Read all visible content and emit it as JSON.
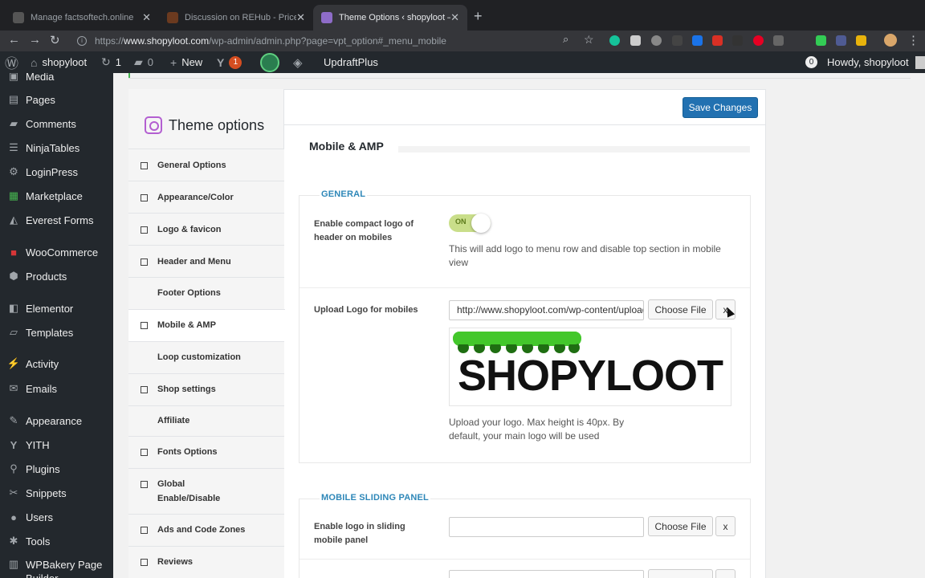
{
  "browser": {
    "tabs": [
      {
        "title": "Manage factsoftech.online",
        "active": false
      },
      {
        "title": "Discussion on REHub - Price C",
        "active": false
      },
      {
        "title": "Theme Options ‹ shopyloot —",
        "active": true
      }
    ],
    "url": {
      "scheme": "https://",
      "host": "www.shopyloot.com",
      "path": "/wp-admin/admin.php?page=vpt_option#_menu_mobile"
    }
  },
  "adminbar": {
    "site_name": "shopyloot",
    "updates_count": "1",
    "comments_count": "0",
    "new_label": "New",
    "yoast_badge": "1",
    "updraft_label": "UpdraftPlus",
    "notif_count": "0",
    "howdy": "Howdy, shopyloot"
  },
  "sidebar": {
    "items": [
      {
        "label": "Media",
        "icon": "media-icon"
      },
      {
        "label": "Pages",
        "icon": "pages-icon"
      },
      {
        "label": "Comments",
        "icon": "comments-icon"
      },
      {
        "label": "NinjaTables",
        "icon": "table-icon"
      },
      {
        "label": "LoginPress",
        "icon": "gear-icon"
      },
      {
        "label": "Marketplace",
        "icon": "grid-icon"
      },
      {
        "label": "Everest Forms",
        "icon": "forms-icon"
      },
      {
        "label": "WooCommerce",
        "icon": "woocommerce-icon"
      },
      {
        "label": "Products",
        "icon": "box-icon"
      },
      {
        "label": "Elementor",
        "icon": "elementor-icon"
      },
      {
        "label": "Templates",
        "icon": "folder-icon"
      },
      {
        "label": "Activity",
        "icon": "activity-icon"
      },
      {
        "label": "Emails",
        "icon": "mail-icon"
      },
      {
        "label": "Appearance",
        "icon": "brush-icon"
      },
      {
        "label": "YITH",
        "icon": "yith-icon"
      },
      {
        "label": "Plugins",
        "icon": "plug-icon"
      },
      {
        "label": "Snippets",
        "icon": "scissors-icon"
      },
      {
        "label": "Users",
        "icon": "user-icon"
      },
      {
        "label": "Tools",
        "icon": "wrench-icon"
      },
      {
        "label": "WPBakery Page Builder",
        "icon": "builder-icon"
      }
    ]
  },
  "theme": {
    "brand_title": "Theme options",
    "save_label": "Save Changes",
    "nav": [
      {
        "label": "General Options",
        "checkbox": true
      },
      {
        "label": "Appearance/Color",
        "checkbox": true
      },
      {
        "label": "Logo & favicon",
        "checkbox": true
      },
      {
        "label": "Header and Menu",
        "checkbox": true
      },
      {
        "label": "Footer Options",
        "checkbox": false
      },
      {
        "label": "Mobile & AMP",
        "checkbox": true,
        "active": true
      },
      {
        "label": "Loop customization",
        "checkbox": false
      },
      {
        "label": "Shop settings",
        "checkbox": true
      },
      {
        "label": "Affiliate",
        "checkbox": false
      },
      {
        "label": "Fonts Options",
        "checkbox": true
      },
      {
        "label": "Global Enable/Disable",
        "checkbox": true
      },
      {
        "label": "Ads and Code Zones",
        "checkbox": true
      },
      {
        "label": "Reviews",
        "checkbox": true
      }
    ],
    "section_title": "Mobile & AMP",
    "general": {
      "title": "GENERAL",
      "compact_logo_label": "Enable compact logo of header on mobiles",
      "toggle_state": "ON",
      "compact_logo_desc": "This will add logo to menu row and disable top section in mobile view",
      "upload_label": "Upload Logo for mobiles",
      "upload_value": "http://www.shopyloot.com/wp-content/uploads/",
      "choose_file": "Choose File",
      "remove": "x",
      "logo_preview_text": "SHOPYLOOT",
      "upload_desc": "Upload your logo. Max height is 40px. By default, your main logo will be used"
    },
    "sliding": {
      "title": "MOBILE SLIDING PANEL",
      "logo_label": "Enable logo in sliding mobile panel",
      "logo_value": "",
      "choose_file": "Choose File",
      "remove": "x"
    }
  }
}
